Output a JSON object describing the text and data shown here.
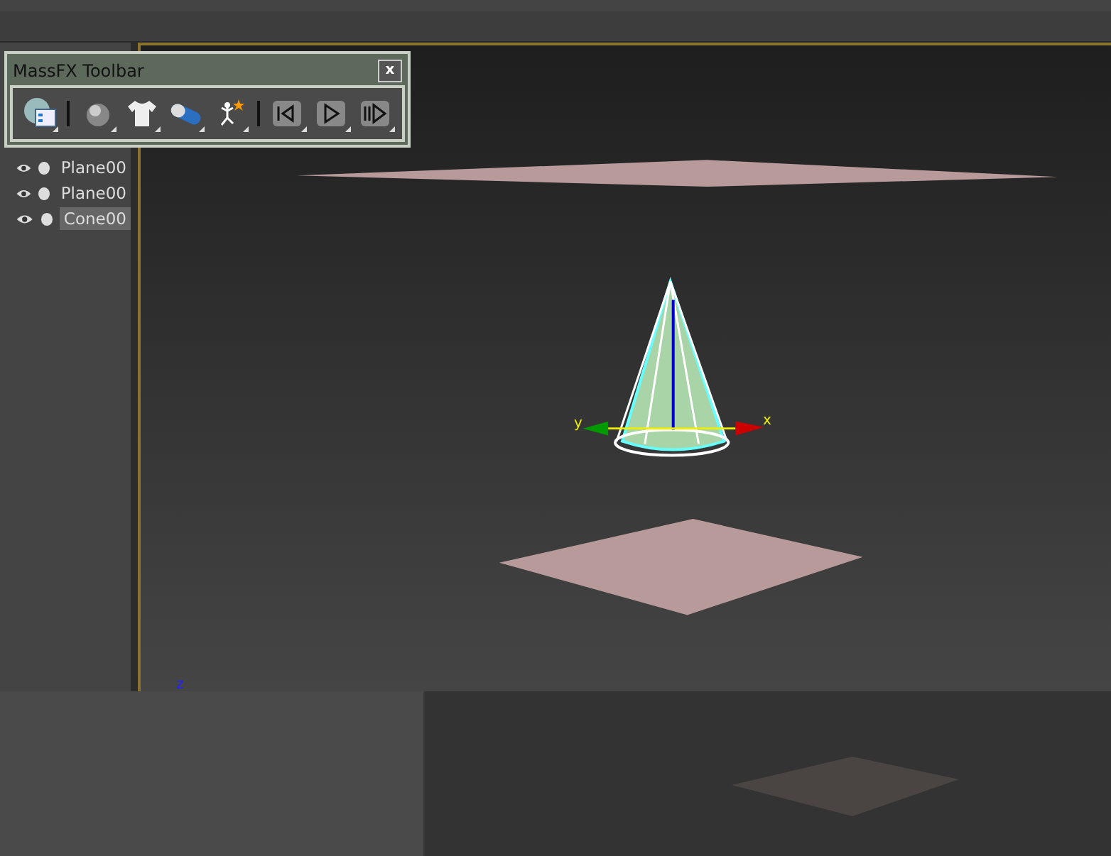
{
  "toolbar": {
    "title": "MassFX Toolbar",
    "close": "x",
    "buttons": [
      {
        "kind": "world"
      },
      {
        "kind": "sep"
      },
      {
        "kind": "sphere"
      },
      {
        "kind": "shirt"
      },
      {
        "kind": "capsule"
      },
      {
        "kind": "ragdoll"
      },
      {
        "kind": "sep"
      },
      {
        "kind": "reset"
      },
      {
        "kind": "play"
      },
      {
        "kind": "step"
      }
    ]
  },
  "scene_explorer": {
    "items": [
      {
        "name": "Plane00",
        "selected": false
      },
      {
        "name": "Plane00",
        "selected": false
      },
      {
        "name": "Cone00",
        "selected": true
      }
    ]
  },
  "viewport": {
    "axis_labels": {
      "x": "x",
      "y": "y",
      "z": "z"
    }
  }
}
